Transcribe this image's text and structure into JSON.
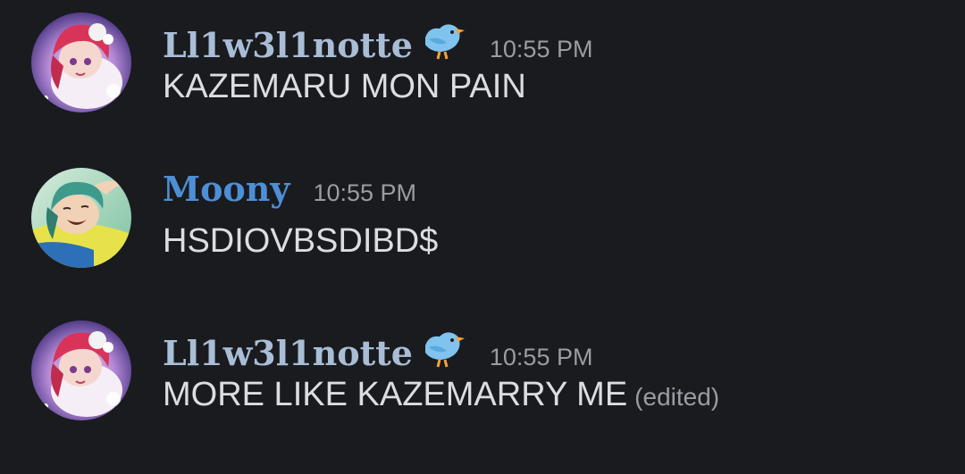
{
  "colors": {
    "background": "#1a1b1f",
    "username_ll1w3l1notte": "#a9bdd6",
    "username_moony": "#4d8fd6",
    "message_text": "#dcdde1",
    "timestamp_text": "#9b9ca3"
  },
  "messages": [
    {
      "username": "Ll1w3l1notte",
      "badge_icon": "bird-icon",
      "timestamp": "10:55 PM",
      "text": "KAZEMARU MON PAIN",
      "edited": ""
    },
    {
      "username": "Moony",
      "badge_icon": "",
      "timestamp": "10:55 PM",
      "text": "HSDIOVBSDIBD$",
      "edited": ""
    },
    {
      "username": "Ll1w3l1notte",
      "badge_icon": "bird-icon",
      "timestamp": "10:55 PM",
      "text": "MORE LIKE KAZEMARRY ME",
      "edited": "(edited)"
    }
  ]
}
